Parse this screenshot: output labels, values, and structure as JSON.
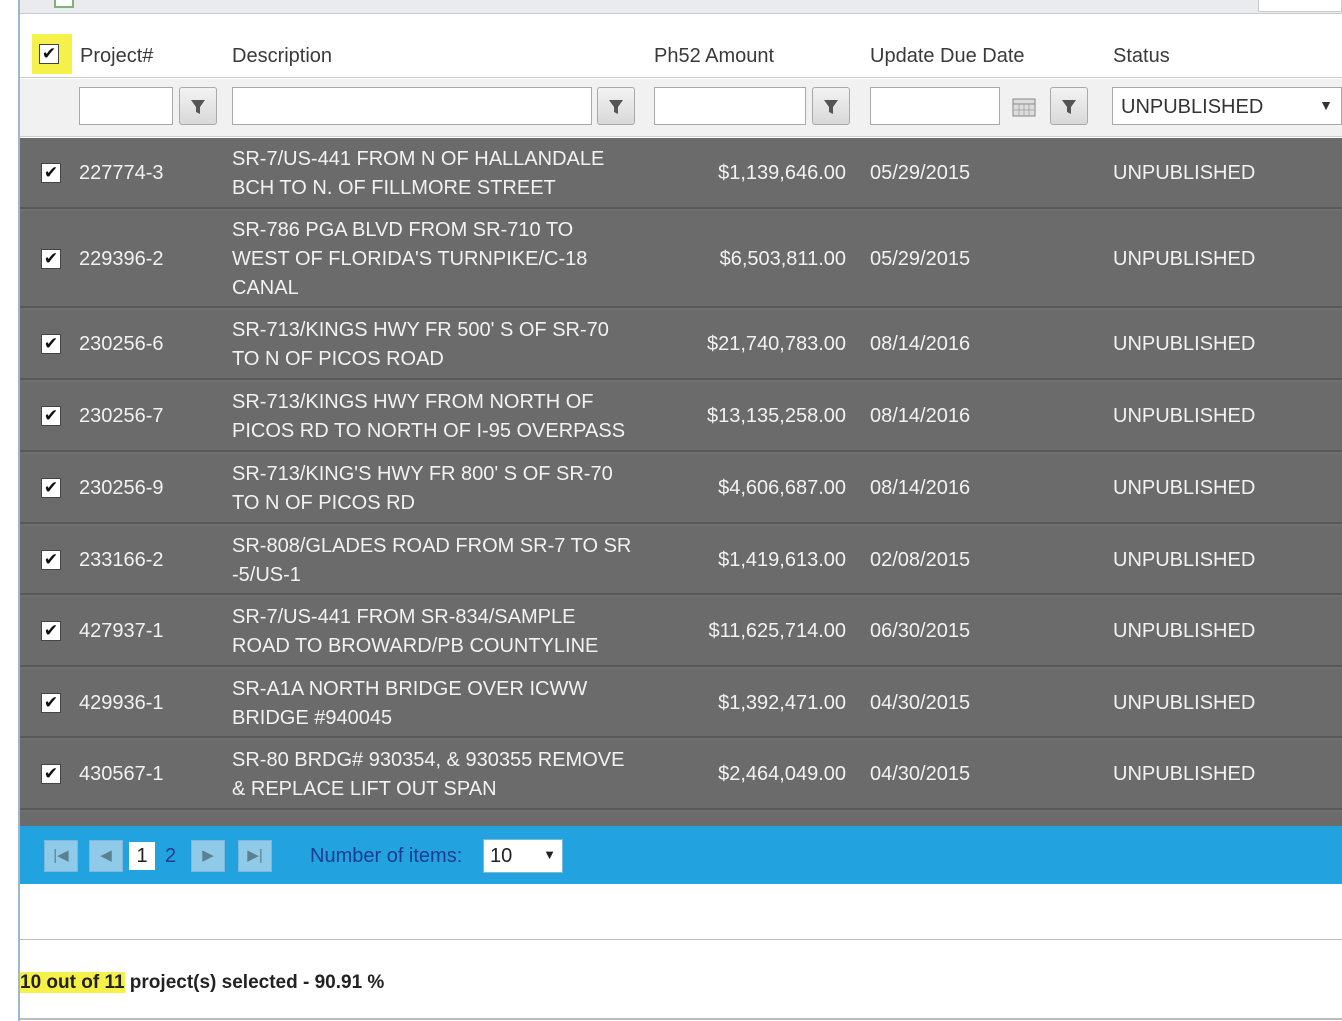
{
  "columns": {
    "project": "Project#",
    "description": "Description",
    "amount": "Ph52 Amount",
    "due_date": "Update Due Date",
    "status": "Status"
  },
  "filters": {
    "status_selected": "UNPUBLISHED"
  },
  "rows": [
    {
      "project": "227774-3",
      "desc_line1": "SR-7/US-441 FROM N OF HALLANDALE",
      "desc_line2": "BCH TO N. OF FILLMORE STREET",
      "desc_line3": "",
      "amount": "$1,139,646.00",
      "date": "05/29/2015",
      "status": "UNPUBLISHED",
      "checked": true
    },
    {
      "project": "229396-2",
      "desc_line1": "SR-786 PGA BLVD FROM SR-710 TO",
      "desc_line2": "WEST OF FLORIDA'S TURNPIKE/C-18",
      "desc_line3": "CANAL",
      "amount": "$6,503,811.00",
      "date": "05/29/2015",
      "status": "UNPUBLISHED",
      "checked": true
    },
    {
      "project": "230256-6",
      "desc_line1": "SR-713/KINGS HWY FR 500' S OF SR-70",
      "desc_line2": "TO N OF PICOS ROAD",
      "desc_line3": "",
      "amount": "$21,740,783.00",
      "date": "08/14/2016",
      "status": "UNPUBLISHED",
      "checked": true
    },
    {
      "project": "230256-7",
      "desc_line1": "SR-713/KINGS HWY FROM NORTH OF",
      "desc_line2": "PICOS RD TO NORTH OF I-95 OVERPASS",
      "desc_line3": "",
      "amount": "$13,135,258.00",
      "date": "08/14/2016",
      "status": "UNPUBLISHED",
      "checked": true
    },
    {
      "project": "230256-9",
      "desc_line1": "SR-713/KING'S HWY FR 800' S OF SR-70",
      "desc_line2": "TO N OF PICOS RD",
      "desc_line3": "",
      "amount": "$4,606,687.00",
      "date": "08/14/2016",
      "status": "UNPUBLISHED",
      "checked": true
    },
    {
      "project": "233166-2",
      "desc_line1": "SR-808/GLADES ROAD FROM SR-7 TO SR",
      "desc_line2": "-5/US-1",
      "desc_line3": "",
      "amount": "$1,419,613.00",
      "date": "02/08/2015",
      "status": "UNPUBLISHED",
      "checked": true
    },
    {
      "project": "427937-1",
      "desc_line1": "SR-7/US-441 FROM SR-834/SAMPLE",
      "desc_line2": "ROAD TO BROWARD/PB COUNTYLINE",
      "desc_line3": "",
      "amount": "$11,625,714.00",
      "date": "06/30/2015",
      "status": "UNPUBLISHED",
      "checked": true
    },
    {
      "project": "429936-1",
      "desc_line1": "SR-A1A NORTH BRIDGE OVER ICWW",
      "desc_line2": "BRIDGE #940045",
      "desc_line3": "",
      "amount": "$1,392,471.00",
      "date": "04/30/2015",
      "status": "UNPUBLISHED",
      "checked": true
    },
    {
      "project": "430567-1",
      "desc_line1": "SR-80 BRDG# 930354, & 930355 REMOVE",
      "desc_line2": "& REPLACE LIFT OUT SPAN",
      "desc_line3": "",
      "amount": "$2,464,049.00",
      "date": "04/30/2015",
      "status": "UNPUBLISHED",
      "checked": true
    }
  ],
  "pager": {
    "first": "|◀",
    "prev": "◀",
    "current_page": "1",
    "other_page": "2",
    "next": "▶",
    "last": "▶|",
    "items_label": "Number of items:",
    "items_value": "10"
  },
  "summary": {
    "highlight": "10 out of 11",
    "rest": " project(s) selected - 90.91 %"
  },
  "colors": {
    "row_bg": "#6b6b6b",
    "pager_bg": "#22a3df",
    "highlight": "#f6f04a"
  }
}
